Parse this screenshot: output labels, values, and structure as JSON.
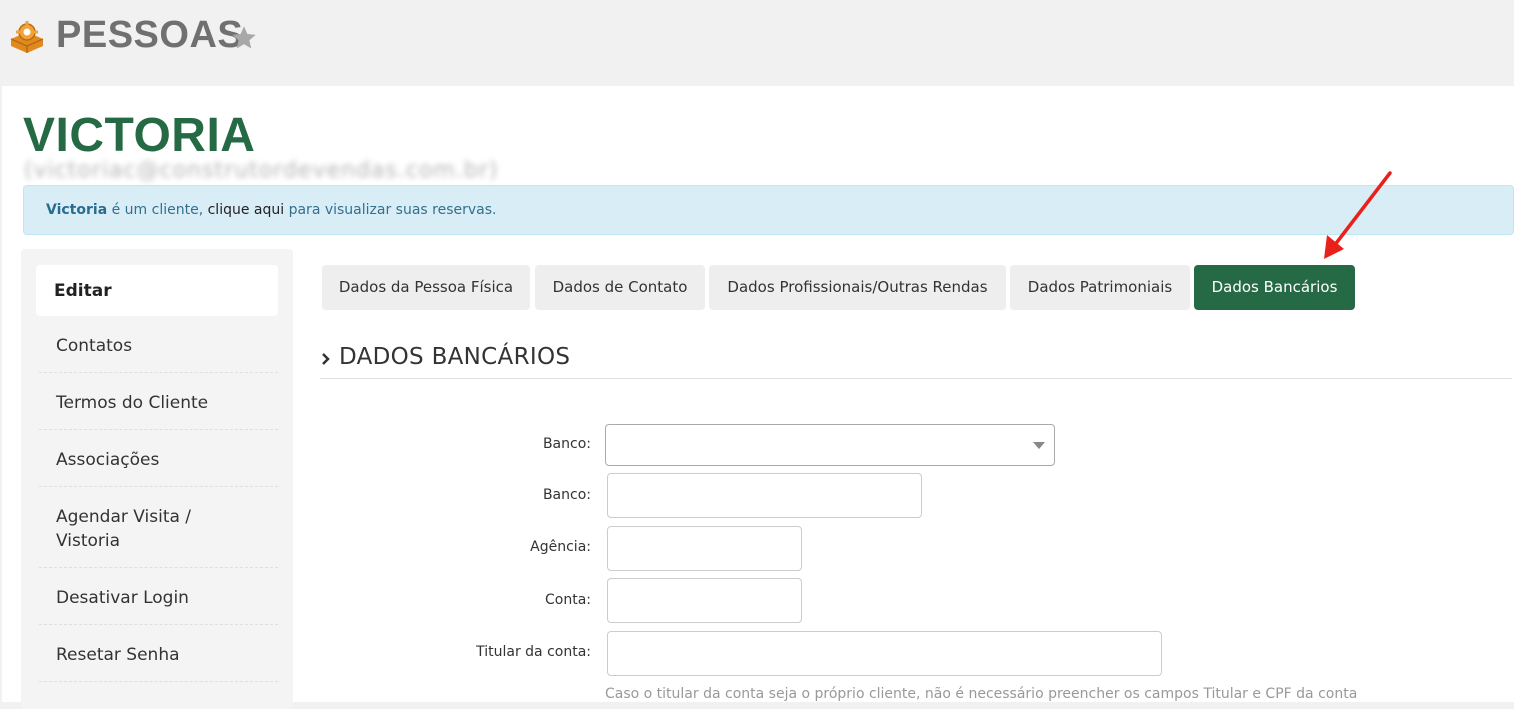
{
  "header": {
    "title": "PESSOAS",
    "logo_icon": "gear-box-logo",
    "favorite_icon": "star-icon"
  },
  "person": {
    "name": "VICTORIA",
    "email": "(victoriac@construtordevendas.com.br)"
  },
  "alert": {
    "name": "Victoria",
    "text_mid": " é um cliente, ",
    "text_plain": "clique aqui",
    "text_end": " para visualizar suas reservas."
  },
  "sidebar": {
    "active_label": "Editar",
    "items": [
      {
        "label": "Contatos"
      },
      {
        "label": "Termos do Cliente"
      },
      {
        "label": "Associações"
      },
      {
        "label": "Agendar Visita /"
      },
      {
        "label": "Vistoria"
      },
      {
        "label": "Desativar Login"
      },
      {
        "label": "Resetar Senha"
      }
    ]
  },
  "tabs": [
    {
      "label": "Dados da Pessoa Física"
    },
    {
      "label": "Dados de Contato"
    },
    {
      "label": "Dados Profissionais/Outras Rendas"
    },
    {
      "label": "Dados Patrimoniais"
    },
    {
      "label": "Dados Bancários",
      "active": true
    }
  ],
  "section": {
    "title": "DADOS BANCÁRIOS",
    "chevron_icon": "chevron-right-icon"
  },
  "form": {
    "banco_select_label": "Banco:",
    "banco_select_value": "",
    "banco_label": "Banco:",
    "banco_value": "",
    "agencia_label": "Agência:",
    "agencia_value": "",
    "conta_label": "Conta:",
    "conta_value": "",
    "titular_label": "Titular da conta:",
    "titular_value": "",
    "help_text": "Caso o titular da conta seja o próprio cliente, não é necessário preencher os campos Titular e CPF da conta"
  },
  "colors": {
    "brand_green": "#256a45",
    "annotation_red": "#e8221b",
    "alert_bg": "#d9edf7",
    "logo_orange": "#e08a1e"
  }
}
